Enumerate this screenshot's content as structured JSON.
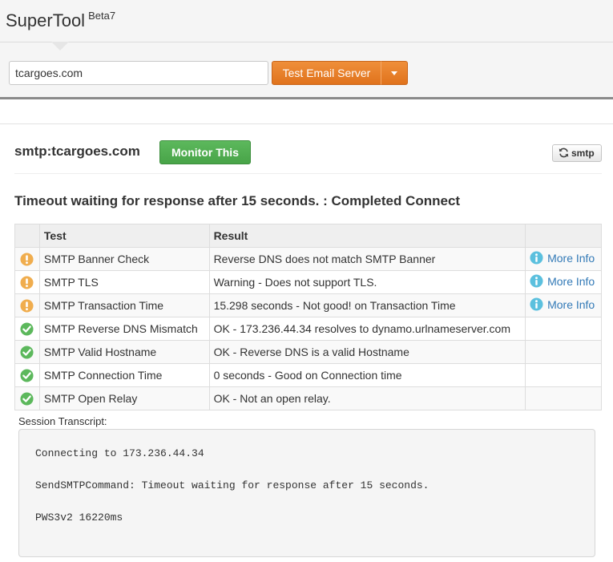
{
  "header": {
    "brand": "SuperTool",
    "beta": "Beta7",
    "domain_value": "tcargoes.com",
    "test_button_label": "Test Email Server"
  },
  "title_row": {
    "title": "smtp:tcargoes.com",
    "monitor_label": "Monitor This",
    "refresh_label": "smtp"
  },
  "status_heading": "Timeout waiting for response after 15 seconds. : Completed Connect",
  "table": {
    "headers": {
      "test": "Test",
      "result": "Result"
    },
    "rows": [
      {
        "status": "warning",
        "test": "SMTP Banner Check",
        "result": "Reverse DNS does not match SMTP Banner",
        "more": "More Info"
      },
      {
        "status": "warning",
        "test": "SMTP TLS",
        "result": "Warning - Does not support TLS.",
        "more": "More Info"
      },
      {
        "status": "warning",
        "test": "SMTP Transaction Time",
        "result": "15.298 seconds - Not good! on Transaction Time",
        "more": "More Info"
      },
      {
        "status": "ok",
        "test": "SMTP Reverse DNS Mismatch",
        "result": "OK - 173.236.44.34 resolves to dynamo.urlnameserver.com",
        "more": ""
      },
      {
        "status": "ok",
        "test": "SMTP Valid Hostname",
        "result": "OK - Reverse DNS is a valid Hostname",
        "more": ""
      },
      {
        "status": "ok",
        "test": "SMTP Connection Time",
        "result": "0 seconds - Good on Connection time",
        "more": ""
      },
      {
        "status": "ok",
        "test": "SMTP Open Relay",
        "result": "OK - Not an open relay.",
        "more": ""
      }
    ]
  },
  "transcript": {
    "label": "Session Transcript:",
    "lines": [
      "Connecting to 173.236.44.34",
      "SendSMTPCommand: Timeout waiting for response after 15 seconds.",
      "PWS3v2 16220ms"
    ]
  },
  "colors": {
    "warning": "#f0ad4e",
    "ok": "#5cb85c",
    "info": "#5bc0de",
    "accent_orange": "#e87e2a"
  },
  "icons": {
    "warning": "exclamation-circle-icon",
    "ok": "check-circle-icon",
    "info": "info-circle-icon",
    "refresh": "refresh-icon",
    "dropdown": "caret-down-icon"
  }
}
